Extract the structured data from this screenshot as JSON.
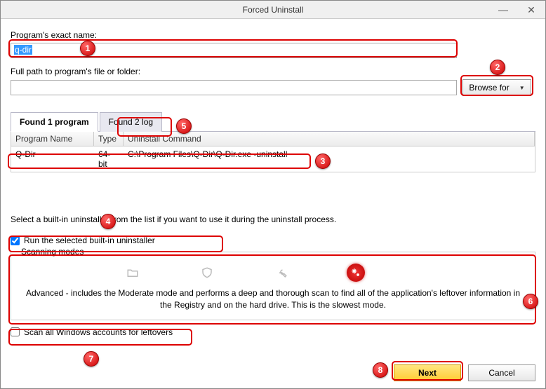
{
  "window": {
    "title": "Forced Uninstall"
  },
  "labels": {
    "program_name": "Program's exact name:",
    "full_path": "Full path to program's file or folder:",
    "browse": "Browse for",
    "instruct": "Select a built-in uninstaller from the list if you want to use it during the uninstall process.",
    "run_builtin": "Run the selected built-in uninstaller",
    "modes_legend": "Scanning modes",
    "mode_desc": "Advanced - includes the Moderate mode and performs a deep and thorough scan to find all of the application's leftover information in the Registry and on the hard drive. This is the slowest mode.",
    "scan_all": "Scan all Windows accounts for leftovers",
    "next": "Next",
    "cancel": "Cancel"
  },
  "inputs": {
    "program_name_value": "q-dir",
    "path_value": ""
  },
  "tabs": [
    {
      "label": "Found 1 program",
      "active": true
    },
    {
      "label": "Found 2 log",
      "active": false
    }
  ],
  "table": {
    "headers": {
      "c1": "Program Name",
      "c2": "Type",
      "c3": "Uninstall Command"
    },
    "rows": [
      {
        "name": "Q-Dir",
        "type": "64-bit",
        "cmd": "C:\\Program Files\\Q-Dir\\Q-Dir.exe -uninstall"
      }
    ]
  },
  "checks": {
    "run_builtin": true,
    "scan_all": false
  },
  "callouts": {
    "1": "1",
    "2": "2",
    "3": "3",
    "4": "4",
    "5": "5",
    "6": "6",
    "7": "7",
    "8": "8"
  },
  "mode_icons": [
    "folder-icon",
    "shield-icon",
    "wrench-icon",
    "gears-icon"
  ]
}
